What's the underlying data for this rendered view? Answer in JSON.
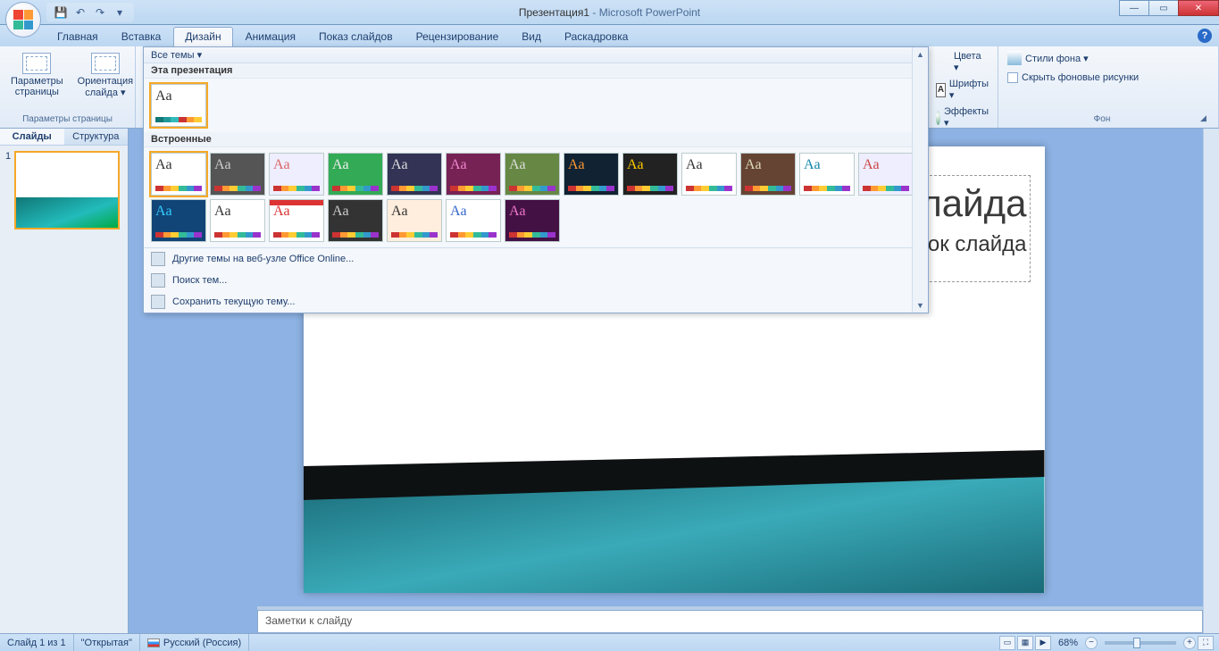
{
  "title": {
    "doc": "Презентация1",
    "app": "Microsoft PowerPoint"
  },
  "qat": {
    "save": "💾",
    "undo": "↶",
    "redo": "↷",
    "more": "▾"
  },
  "win": {
    "min": "—",
    "max": "▭",
    "close": "✕"
  },
  "tabs": {
    "home": "Главная",
    "insert": "Вставка",
    "design": "Дизайн",
    "anim": "Анимация",
    "slideshow": "Показ слайдов",
    "review": "Рецензирование",
    "view": "Вид",
    "storyboard": "Раскадровка"
  },
  "ribbon": {
    "pageSetup": {
      "params": "Параметры страницы",
      "orient": "Ориентация слайда ▾",
      "group": "Параметры страницы"
    },
    "themes": {
      "allThemes": "Все темы ▾",
      "thisPresentation": "Эта презентация",
      "builtIn": "Встроенные",
      "menuOnline": "Другие темы на веб-узле Office Online...",
      "menuBrowse": "Поиск тем...",
      "menuSave": "Сохранить текущую тему...",
      "colors": "Цвета ▾",
      "fonts": "Шрифты ▾",
      "effects": "Эффекты ▾"
    },
    "background": {
      "styles": "Стили фона ▾",
      "hide": "Скрыть фоновые рисунки",
      "group": "Фон"
    }
  },
  "sideTabs": {
    "slides": "Слайды",
    "outline": "Структура",
    "slide1num": "1"
  },
  "slide": {
    "title": "Заголовок слайда",
    "subtitle": "Подзаголовок слайда"
  },
  "notes": {
    "placeholder": "Заметки к слайду"
  },
  "status": {
    "slideOf": "Слайд 1 из 1",
    "theme": "\"Открытая\"",
    "lang": "Русский (Россия)",
    "zoom": "68%"
  },
  "themeThumbs": {
    "row1": [
      {
        "bg": "#fff",
        "aa": "#333",
        "sel": true
      },
      {
        "bg": "#555",
        "aa": "#ccc"
      },
      {
        "bg": "#eef",
        "aa": "#d66"
      },
      {
        "bg": "#3a5",
        "aa": "#eee"
      },
      {
        "bg": "#335",
        "aa": "#ddd"
      },
      {
        "bg": "#725",
        "aa": "#e8c"
      },
      {
        "bg": "#684",
        "aa": "#ddd"
      },
      {
        "bg": "#123",
        "aa": "#f93"
      },
      {
        "bg": "#222",
        "aa": "#fc0"
      },
      {
        "bg": "#fff",
        "aa": "#333"
      },
      {
        "bg": "#643",
        "aa": "#ddb"
      },
      {
        "bg": "#fff",
        "aa": "#18a"
      }
    ],
    "row2": [
      {
        "bg": "#eef",
        "aa": "#c44"
      },
      {
        "bg": "#147",
        "aa": "#3cf"
      },
      {
        "bg": "#fff",
        "aa": "#333"
      },
      {
        "bg": "#fff",
        "aa": "#d33",
        "top": "#d33"
      },
      {
        "bg": "#333",
        "aa": "#ccc"
      },
      {
        "bg": "#fed",
        "aa": "#333"
      },
      {
        "bg": "#fff",
        "aa": "#36c"
      },
      {
        "bg": "#414",
        "aa": "#e7c"
      }
    ]
  }
}
